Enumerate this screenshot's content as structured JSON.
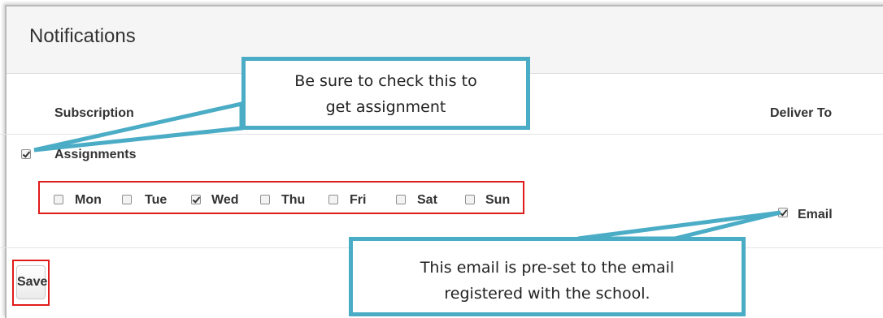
{
  "panel": {
    "title": "Notifications",
    "columns": {
      "subscription": "Subscription",
      "deliver_to": "Deliver To"
    }
  },
  "subscription": {
    "name": "Assignments",
    "checked": true,
    "days": [
      {
        "label": "Mon",
        "checked": false
      },
      {
        "label": "Tue",
        "checked": false
      },
      {
        "label": "Wed",
        "checked": true
      },
      {
        "label": "Thu",
        "checked": false
      },
      {
        "label": "Fri",
        "checked": false
      },
      {
        "label": "Sat",
        "checked": false
      },
      {
        "label": "Sun",
        "checked": false
      }
    ],
    "deliver": {
      "label": "Email",
      "checked": true
    }
  },
  "save_label": "Save",
  "callouts": {
    "top_lines": [
      "Be sure to check this to",
      "get assignment"
    ],
    "bottom_lines": [
      "This email is pre-set to the email",
      "registered with the school."
    ]
  },
  "colors": {
    "callout_border": "#4bacc6",
    "highlight_red": "#e01b1b",
    "header_bg": "#f5f5f5"
  }
}
